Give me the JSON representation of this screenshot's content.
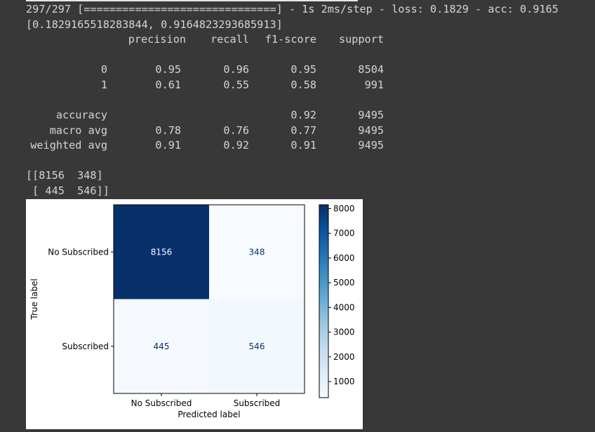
{
  "console": {
    "progress_line": "297/297 [==============================] - 1s 2ms/step - loss: 0.1829 - acc: 0.9165",
    "eval_result": "[0.1829165518283844, 0.9164823293685913]"
  },
  "report": {
    "headers": [
      "precision",
      "recall",
      "f1-score",
      "support"
    ],
    "rows": [
      {
        "label": "0",
        "precision": "0.95",
        "recall": "0.96",
        "f1": "0.95",
        "support": "8504"
      },
      {
        "label": "1",
        "precision": "0.61",
        "recall": "0.55",
        "f1": "0.58",
        "support": "991"
      },
      {
        "label": "accuracy",
        "precision": "",
        "recall": "",
        "f1": "0.92",
        "support": "9495"
      },
      {
        "label": "macro avg",
        "precision": "0.78",
        "recall": "0.76",
        "f1": "0.77",
        "support": "9495"
      },
      {
        "label": "weighted avg",
        "precision": "0.91",
        "recall": "0.92",
        "f1": "0.91",
        "support": "9495"
      }
    ]
  },
  "matrix_text": {
    "line1": "[[8156  348]",
    "line2": " [ 445  546]]"
  },
  "chart_data": {
    "type": "heatmap",
    "x_categories": [
      "No Subscribed",
      "Subscribed"
    ],
    "y_categories": [
      "No Subscribed",
      "Subscribed"
    ],
    "values": [
      [
        8156,
        348
      ],
      [
        445,
        546
      ]
    ],
    "xlabel": "Predicted label",
    "ylabel": "True label",
    "colorbar": {
      "ticks": [
        1000,
        2000,
        3000,
        4000,
        5000,
        6000,
        7000,
        8000
      ],
      "range": [
        348,
        8156
      ],
      "colormap": "Blues"
    },
    "colors": {
      "max": "#08306b",
      "min": "#f7fbff",
      "text_dark": "#08306b",
      "text_light": "#f7fbff"
    }
  }
}
